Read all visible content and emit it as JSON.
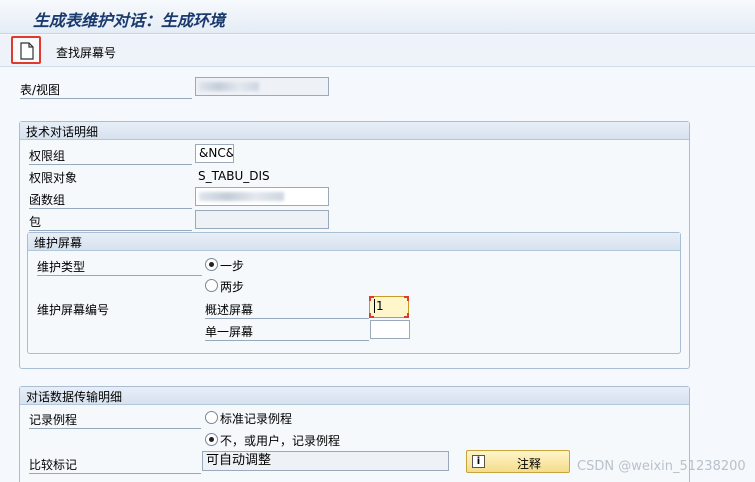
{
  "window": {
    "title": "生成表维护对话：生成环境"
  },
  "toolbar": {
    "find_screen_label": "查找屏幕号"
  },
  "table_view": {
    "label": "表/视图"
  },
  "tech_group": {
    "title": "技术对话明细",
    "auth_group_label": "权限组",
    "auth_group_value": "&NC&",
    "auth_object_label": "权限对象",
    "auth_object_value": "S_TABU_DIS",
    "function_group_label": "函数组",
    "package_label": "包",
    "maint_screen": {
      "title": "维护屏幕",
      "maint_type_label": "维护类型",
      "option_one_step": "一步",
      "option_two_step": "两步",
      "screen_no_label": "维护屏幕编号",
      "overview_screen_label": "概述屏幕",
      "overview_screen_value": "1",
      "single_screen_label": "单一屏幕",
      "single_screen_value": ""
    }
  },
  "transport_group": {
    "title": "对话数据传输明细",
    "record_routine_label": "记录例程",
    "option_standard_routine": "标准记录例程",
    "option_no_routine": "不，或用户，记录例程",
    "compare_flag_label": "比较标记",
    "compare_flag_value": "可自动调整",
    "note_button_label": "注释"
  },
  "watermark": "CSDN @weixin_51238200",
  "selection": {
    "maint_type": "一步",
    "record_routine": "不，或用户，记录例程"
  }
}
